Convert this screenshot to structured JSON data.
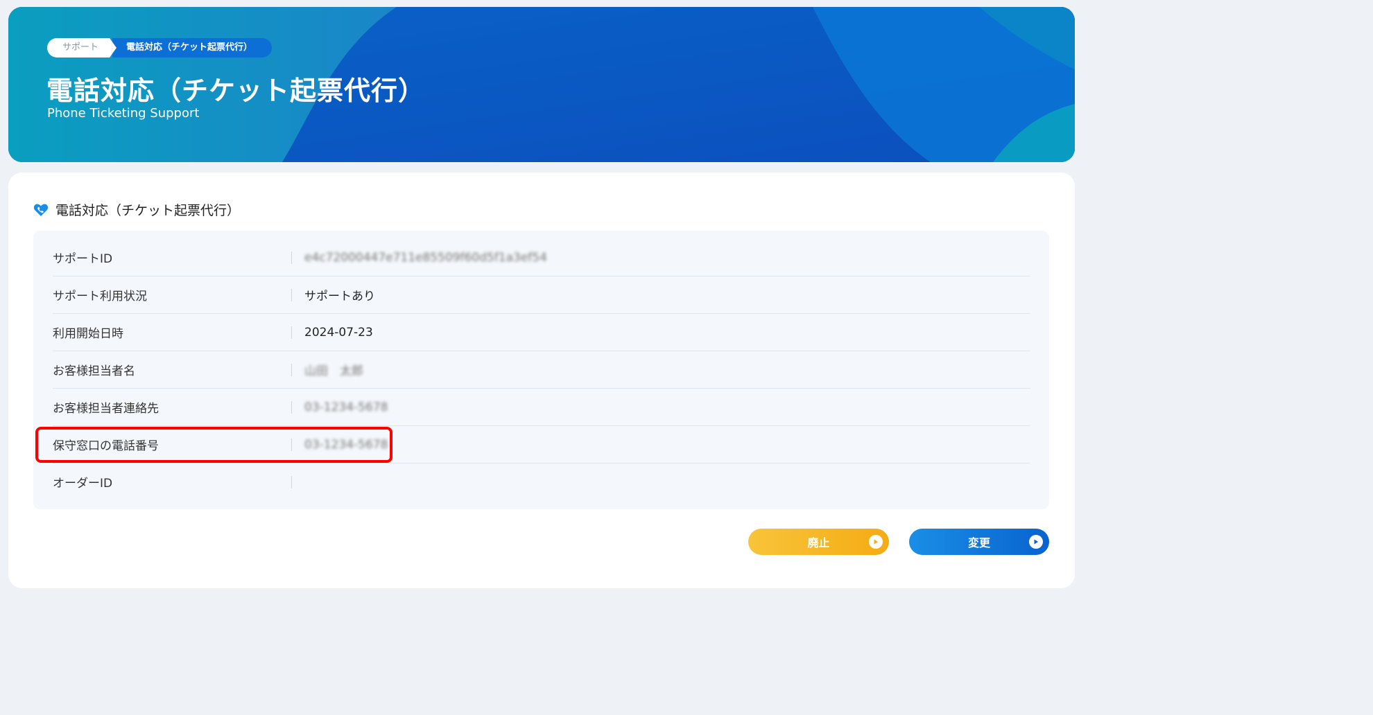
{
  "breadcrumb": {
    "home": "サポート",
    "current": "電話対応（チケット起票代行）"
  },
  "hero": {
    "title": "電話対応（チケット起票代行）",
    "subtitle": "Phone Ticketing Support"
  },
  "section": {
    "title": "電話対応（チケット起票代行）",
    "icon": "phone-heart-icon"
  },
  "rows": [
    {
      "label": "サポートID",
      "value": "e4c72000447e711e85509f60d5f1a3ef54"
    },
    {
      "label": "サポート利用状況",
      "value": "サポートあり"
    },
    {
      "label": "利用開始日時",
      "value": "2024-07-23"
    },
    {
      "label": "お客様担当者名",
      "value": "山田　太郎"
    },
    {
      "label": "お客様担当者連絡先",
      "value": "03-1234-5678"
    },
    {
      "label": "保守窓口の電話番号",
      "value": "03-1234-5678"
    },
    {
      "label": "オーダーID",
      "value": ""
    }
  ],
  "buttons": {
    "cancel": "廃止",
    "change": "変更"
  },
  "colors": {
    "accent_blue": "#0863cf",
    "cancel_yellow": "#f5ab14",
    "highlight_red": "#ff0000"
  }
}
